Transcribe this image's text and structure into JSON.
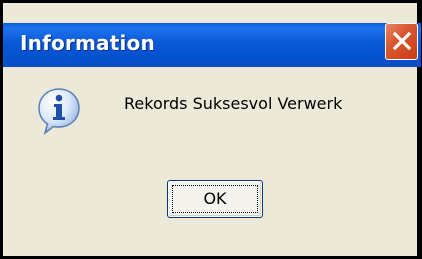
{
  "window": {
    "title": "Information",
    "close_icon": "close-icon",
    "close_color": "#d9572f",
    "titlebar_color": "#0a58d6"
  },
  "content": {
    "icon": "information-icon",
    "message": "Rekords Suksesvol Verwerk"
  },
  "buttons": {
    "ok_label": "OK"
  }
}
